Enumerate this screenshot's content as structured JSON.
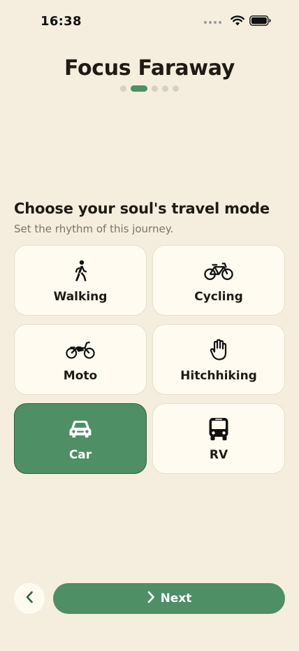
{
  "status_bar": {
    "time": "16:38",
    "icons": [
      "signal-dots-icon",
      "wifi-icon",
      "battery-icon"
    ]
  },
  "app": {
    "title": "Focus Faraway"
  },
  "pager": {
    "total_steps": 5,
    "current_step": 2
  },
  "section": {
    "heading": "Choose your soul's travel mode",
    "subheading": "Set the rhythm of this journey."
  },
  "modes": [
    {
      "label": "Walking",
      "icon": "walking-icon",
      "selected": false
    },
    {
      "label": "Cycling",
      "icon": "bicycle-icon",
      "selected": false
    },
    {
      "label": "Moto",
      "icon": "motorcycle-icon",
      "selected": false
    },
    {
      "label": "Hitchhiking",
      "icon": "hand-icon",
      "selected": false
    },
    {
      "label": "Car",
      "icon": "car-icon",
      "selected": true
    },
    {
      "label": "RV",
      "icon": "bus-icon",
      "selected": false
    }
  ],
  "footer": {
    "back_icon": "chevron-left-icon",
    "next_label": "Next",
    "next_icon": "chevron-right-icon"
  },
  "colors": {
    "background": "#F5EEDF",
    "accent": "#4E8F65",
    "card": "#FFFBF0",
    "card_border": "#E6DFCC",
    "text": "#1F1A14",
    "muted": "#7A7468"
  }
}
